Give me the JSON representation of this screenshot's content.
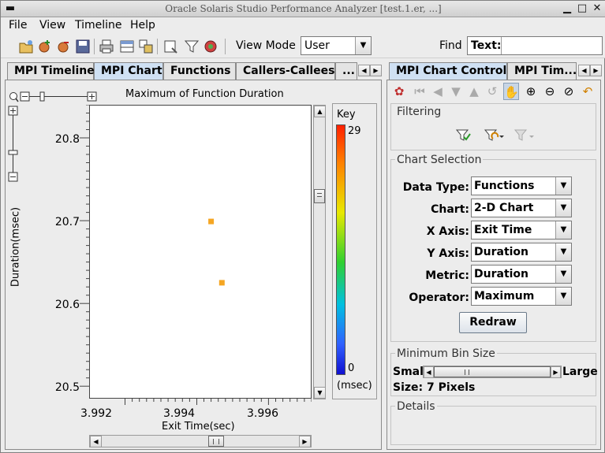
{
  "window": {
    "title": "Oracle Solaris Studio Performance Analyzer [test.1.er, ...]"
  },
  "menubar": {
    "items": [
      "File",
      "View",
      "Timeline",
      "Help"
    ]
  },
  "toolbar": {
    "view_mode_label": "View Mode",
    "view_mode_value": "User",
    "find_label": "Find",
    "text_label": "Text:",
    "text_value": ""
  },
  "left_tabs": [
    "MPI Timeline",
    "MPI Chart",
    "Functions",
    "Callers-Callees",
    "..."
  ],
  "right_tabs": [
    "MPI Chart Controls",
    "MPI Tim..."
  ],
  "chart_header": {
    "title": "Maximum of Function Duration"
  },
  "chart_data": {
    "type": "scatter",
    "title": "Maximum of Function Duration",
    "xlabel": "Exit Time(sec)",
    "ylabel": "Duration(msec)",
    "x_ticks": [
      "3.992",
      "3.994",
      "3.996"
    ],
    "y_ticks": [
      "20.8",
      "20.7",
      "20.6",
      "20.5"
    ],
    "xlim": [
      3.991,
      3.9972
    ],
    "ylim": [
      20.485,
      20.84
    ],
    "points": [
      {
        "x": 3.9944,
        "y": 20.699
      },
      {
        "x": 3.9947,
        "y": 20.625
      }
    ],
    "point_color": "#f5a623",
    "legend": {
      "title": "Key",
      "max": "29",
      "min": "0",
      "unit": "(msec)"
    }
  },
  "controls": {
    "filtering_title": "Filtering",
    "chart_selection_title": "Chart Selection",
    "fields": [
      {
        "label": "Data Type:",
        "value": "Functions"
      },
      {
        "label": "Chart:",
        "value": "2-D Chart"
      },
      {
        "label": "X Axis:",
        "value": "Exit Time"
      },
      {
        "label": "Y Axis:",
        "value": "Duration"
      },
      {
        "label": "Metric:",
        "value": "Duration"
      },
      {
        "label": "Operator:",
        "value": "Maximum"
      }
    ],
    "redraw_label": "Redraw",
    "min_bin_title": "Minimum Bin Size",
    "small_label": "Small",
    "large_label": "Large",
    "size_text": "Size: 7 Pixels",
    "details_title": "Details"
  }
}
